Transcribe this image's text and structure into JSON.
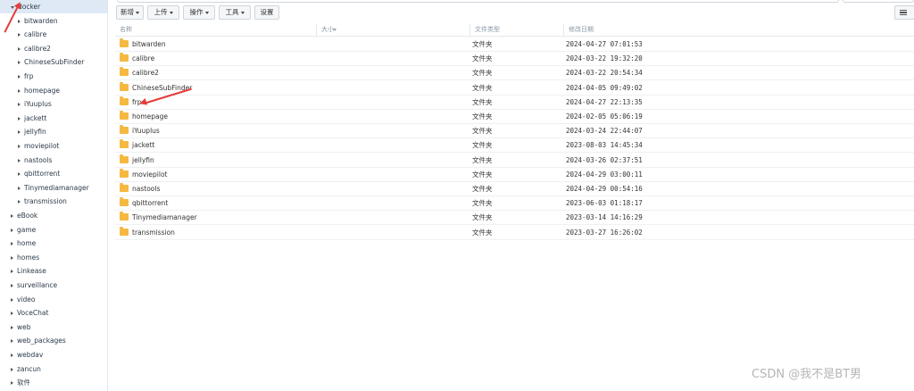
{
  "sidebar": {
    "items": [
      {
        "label": "docker",
        "expanded": true,
        "selected": true,
        "level": 0
      },
      {
        "label": "bitwarden",
        "level": 1
      },
      {
        "label": "calibre",
        "level": 1
      },
      {
        "label": "calibre2",
        "level": 1
      },
      {
        "label": "ChineseSubFinder",
        "level": 1
      },
      {
        "label": "frp",
        "level": 1
      },
      {
        "label": "homepage",
        "level": 1
      },
      {
        "label": "iYuuplus",
        "level": 1
      },
      {
        "label": "jackett",
        "level": 1
      },
      {
        "label": "jellyfin",
        "level": 1
      },
      {
        "label": "moviepilot",
        "level": 1
      },
      {
        "label": "nastools",
        "level": 1
      },
      {
        "label": "qbittorrent",
        "level": 1
      },
      {
        "label": "Tinymediamanager",
        "level": 1
      },
      {
        "label": "transmission",
        "level": 1
      },
      {
        "label": "eBook",
        "level": 0
      },
      {
        "label": "game",
        "level": 0
      },
      {
        "label": "home",
        "level": 0
      },
      {
        "label": "homes",
        "level": 0
      },
      {
        "label": "Linkease",
        "level": 0
      },
      {
        "label": "surveillance",
        "level": 0
      },
      {
        "label": "video",
        "level": 0
      },
      {
        "label": "VoceChat",
        "level": 0
      },
      {
        "label": "web",
        "level": 0
      },
      {
        "label": "web_packages",
        "level": 0
      },
      {
        "label": "webdav",
        "level": 0
      },
      {
        "label": "zancun",
        "level": 0
      },
      {
        "label": "软件",
        "level": 0
      }
    ]
  },
  "toolbar": {
    "buttons": [
      {
        "label": "新增",
        "dropdown": true
      },
      {
        "label": "上传",
        "dropdown": true
      },
      {
        "label": "操作",
        "dropdown": true
      },
      {
        "label": "工具",
        "dropdown": true
      },
      {
        "label": "设置",
        "dropdown": false
      }
    ],
    "view_icon": "list-view-icon"
  },
  "table": {
    "columns": [
      "名称",
      "大小",
      "文件类型",
      "修改日期"
    ],
    "rows": [
      {
        "name": "bitwarden",
        "type": "文件夹",
        "modified": "2024-04-27 07:01:53"
      },
      {
        "name": "calibre",
        "type": "文件夹",
        "modified": "2024-03-22 19:32:20"
      },
      {
        "name": "calibre2",
        "type": "文件夹",
        "modified": "2024-03-22 20:54:34"
      },
      {
        "name": "ChineseSubFinder",
        "type": "文件夹",
        "modified": "2024-04-05 09:49:02"
      },
      {
        "name": "frp",
        "type": "文件夹",
        "modified": "2024-04-27 22:13:35"
      },
      {
        "name": "homepage",
        "type": "文件夹",
        "modified": "2024-02-05 05:06:19"
      },
      {
        "name": "iYuuplus",
        "type": "文件夹",
        "modified": "2024-03-24 22:44:07"
      },
      {
        "name": "jackett",
        "type": "文件夹",
        "modified": "2023-08-03 14:45:34"
      },
      {
        "name": "jellyfin",
        "type": "文件夹",
        "modified": "2024-03-26 02:37:51"
      },
      {
        "name": "moviepilot",
        "type": "文件夹",
        "modified": "2024-04-29 03:00:11"
      },
      {
        "name": "nastools",
        "type": "文件夹",
        "modified": "2024-04-29 00:54:16"
      },
      {
        "name": "qbittorrent",
        "type": "文件夹",
        "modified": "2023-06-03 01:18:17"
      },
      {
        "name": "Tinymediamanager",
        "type": "文件夹",
        "modified": "2023-03-14 14:16:29"
      },
      {
        "name": "transmission",
        "type": "文件夹",
        "modified": "2023-03-27 16:26:02"
      }
    ],
    "folder_icon": "folder-icon",
    "folder_color": "#f5b942"
  },
  "annotations": {
    "arrow_color": "#e33b3b"
  },
  "watermark": "CSDN @我不是BT男"
}
